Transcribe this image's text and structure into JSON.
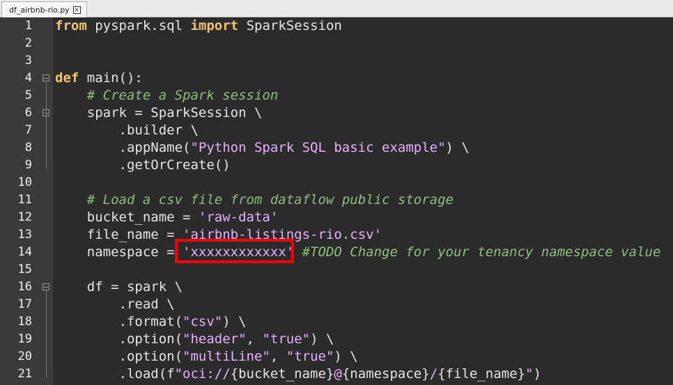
{
  "tab": {
    "filename": "df_airbnb-rio.py",
    "close_icon": "close-icon"
  },
  "lines": [
    {
      "n": "1",
      "segs": [
        {
          "t": "from",
          "c": "kw"
        },
        {
          "t": " pyspark.sql "
        },
        {
          "t": "import",
          "c": "kw"
        },
        {
          "t": " SparkSession"
        }
      ]
    },
    {
      "n": "2",
      "segs": []
    },
    {
      "n": "3",
      "segs": []
    },
    {
      "n": "4",
      "segs": [
        {
          "t": "def",
          "c": "kw"
        },
        {
          "t": " main():"
        }
      ]
    },
    {
      "n": "5",
      "segs": [
        {
          "t": "    "
        },
        {
          "t": "# Create a Spark session",
          "c": "cm"
        }
      ]
    },
    {
      "n": "6",
      "segs": [
        {
          "t": "    spark = SparkSession \\"
        }
      ]
    },
    {
      "n": "7",
      "segs": [
        {
          "t": "        .builder \\"
        }
      ]
    },
    {
      "n": "8",
      "segs": [
        {
          "t": "        .appName("
        },
        {
          "t": "\"Python Spark SQL basic example\"",
          "c": "st"
        },
        {
          "t": ") \\"
        }
      ]
    },
    {
      "n": "9",
      "segs": [
        {
          "t": "        .getOrCreate()"
        }
      ]
    },
    {
      "n": "10",
      "segs": []
    },
    {
      "n": "11",
      "segs": [
        {
          "t": "    "
        },
        {
          "t": "# Load a csv file from dataflow public storage",
          "c": "cm"
        }
      ]
    },
    {
      "n": "12",
      "segs": [
        {
          "t": "    bucket_name = "
        },
        {
          "t": "'raw-data'",
          "c": "st"
        }
      ]
    },
    {
      "n": "13",
      "segs": [
        {
          "t": "    file_name = "
        },
        {
          "t": "'airbnb-listings-rio.csv'",
          "c": "st"
        }
      ]
    },
    {
      "n": "14",
      "segs": [
        {
          "t": "    namespace = "
        },
        {
          "t": "'xxxxxxxxxxxx'",
          "c": "st"
        },
        {
          "t": " "
        },
        {
          "t": "#TODO Change for your tenancy namespace value",
          "c": "cm"
        }
      ]
    },
    {
      "n": "15",
      "segs": []
    },
    {
      "n": "16",
      "segs": [
        {
          "t": "    df = spark \\"
        }
      ]
    },
    {
      "n": "17",
      "segs": [
        {
          "t": "        .read \\"
        }
      ]
    },
    {
      "n": "18",
      "segs": [
        {
          "t": "        .format("
        },
        {
          "t": "\"csv\"",
          "c": "st"
        },
        {
          "t": ") \\"
        }
      ]
    },
    {
      "n": "19",
      "segs": [
        {
          "t": "        .option("
        },
        {
          "t": "\"header\"",
          "c": "st"
        },
        {
          "t": ", "
        },
        {
          "t": "\"true\"",
          "c": "st"
        },
        {
          "t": ") \\"
        }
      ]
    },
    {
      "n": "20",
      "segs": [
        {
          "t": "        .option("
        },
        {
          "t": "\"multiLine\"",
          "c": "st"
        },
        {
          "t": ", "
        },
        {
          "t": "\"true\"",
          "c": "st"
        },
        {
          "t": ") \\"
        }
      ]
    },
    {
      "n": "21",
      "segs": [
        {
          "t": "        .load(f"
        },
        {
          "t": "\"oci://",
          "c": "st"
        },
        {
          "t": "{bucket_name}"
        },
        {
          "t": "@",
          "c": "st"
        },
        {
          "t": "{namespace}"
        },
        {
          "t": "/",
          "c": "st"
        },
        {
          "t": "{file_name}"
        },
        {
          "t": "\"",
          "c": "st"
        },
        {
          "t": ")"
        }
      ]
    }
  ],
  "fold_markers": [
    "4",
    "6",
    "16"
  ],
  "highlight": {
    "color": "#ff0000",
    "target": "'xxxxxxxxxxxx'"
  }
}
